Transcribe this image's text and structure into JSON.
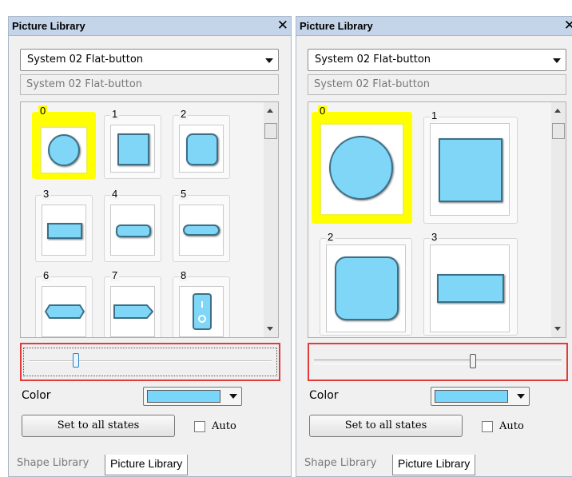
{
  "panels": [
    {
      "title": "Picture Library",
      "close_icon": "close-icon",
      "style_select_value": "System 02 Flat-button",
      "style_name_value": "System 02 Flat-button",
      "tile_numbers": [
        "0",
        "1",
        "2",
        "3",
        "4",
        "5",
        "6",
        "7",
        "8"
      ],
      "color_label": "Color",
      "color_value": "#78d6f8",
      "set_all_label": "Set to all states",
      "auto_label": "Auto",
      "zoom_level": 0.2,
      "tabs": [
        "Shape Library",
        "Picture Library"
      ]
    },
    {
      "title": "Picture Library",
      "close_icon": "close-icon",
      "style_select_value": "System 02 Flat-button",
      "style_name_value": "System 02 Flat-button",
      "tile_numbers": [
        "0",
        "1",
        "2",
        "3"
      ],
      "color_label": "Color",
      "color_value": "#78d6f8",
      "set_all_label": "Set to all states",
      "auto_label": "Auto",
      "zoom_level": 0.65,
      "tabs": [
        "Shape Library",
        "Picture Library"
      ]
    }
  ],
  "colors": {
    "highlight": "#e33a3a",
    "selected_tile": "#ffff00",
    "shape_fill": "#7fd6f7"
  }
}
